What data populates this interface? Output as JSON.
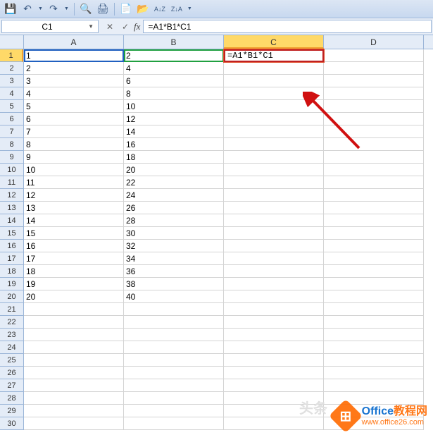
{
  "qat": {
    "save": "💾",
    "undo": "↶",
    "redo": "↷",
    "print_preview": "🔍",
    "print": "🖨",
    "new": "📄",
    "open": "📂",
    "sort_asc": "A↓Z",
    "sort_desc": "Z↓A"
  },
  "name_box": {
    "value": "C1"
  },
  "formula_bar": {
    "cancel": "✕",
    "confirm": "✓",
    "fx": "fx",
    "value": "=A1*B1*C1"
  },
  "columns": [
    "A",
    "B",
    "C",
    "D"
  ],
  "selected_column_index": 2,
  "selected_row_index": 0,
  "row_count": 30,
  "data": {
    "A": [
      "1",
      "2",
      "3",
      "4",
      "5",
      "6",
      "7",
      "8",
      "9",
      "10",
      "11",
      "12",
      "13",
      "14",
      "15",
      "16",
      "17",
      "18",
      "19",
      "20"
    ],
    "B": [
      "2",
      "4",
      "6",
      "8",
      "10",
      "12",
      "14",
      "16",
      "18",
      "20",
      "22",
      "24",
      "26",
      "28",
      "30",
      "32",
      "34",
      "36",
      "38",
      "40"
    ]
  },
  "active_cell_display": "=A1*B1*C1",
  "watermark": {
    "title_main": "Office",
    "title_accent": "教程网",
    "url": "www.office26.com",
    "faded": "头条"
  }
}
